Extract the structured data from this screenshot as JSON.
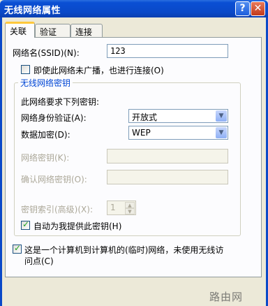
{
  "window": {
    "title": "无线网络属性"
  },
  "titlebar_buttons": {
    "help": "?",
    "close": "✕"
  },
  "tabs": [
    {
      "label": "关联",
      "active": true
    },
    {
      "label": "验证",
      "active": false
    },
    {
      "label": "连接",
      "active": false
    }
  ],
  "network": {
    "ssid_label": "网络名(SSID)(N):",
    "ssid_value": "123",
    "broadcast_checkbox_label": "即使此网络未广播，也进行连接(O)",
    "broadcast_checked": false
  },
  "key_group": {
    "title": "无线网络密钥",
    "intro": "此网络要求下列密钥:",
    "auth_label": "网络身份验证(A):",
    "auth_value": "开放式",
    "encryption_label": "数据加密(D):",
    "encryption_value": "WEP",
    "key_label": "网络密钥(K):",
    "key_value": "",
    "confirm_label": "确认网络密钥(O):",
    "confirm_value": "",
    "index_label": "密钥索引(高级)(X):",
    "index_value": "1",
    "auto_key_label": "自动为我提供此密钥(H)",
    "auto_key_checked": true
  },
  "adhoc": {
    "line1": "这是一个计算机到计算机的(临时)网络，未使用无线访",
    "line2": "问点(C)",
    "checked": true
  },
  "watermark": "路由网"
}
